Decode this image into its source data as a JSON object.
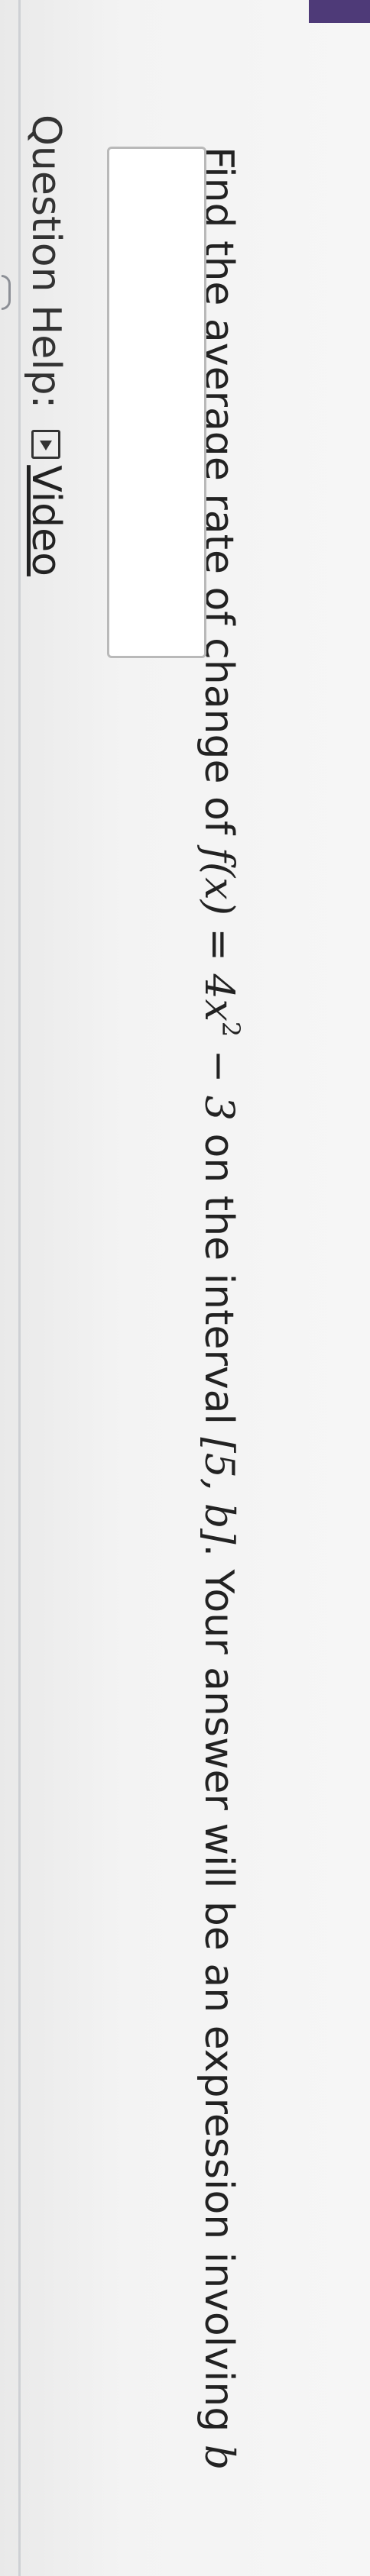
{
  "question": {
    "intro": "Find the average rate of change of ",
    "function_lhs": "f(x)",
    "equals": " = ",
    "function_coef": "4x",
    "function_exp": "2",
    "function_tail": " − 3",
    "on_interval": " on the interval ",
    "interval": "[5, b]",
    "instruction": ". Your answer will be an expression involving ",
    "variable": "b"
  },
  "answer_input": {
    "value": ""
  },
  "help": {
    "label": "Question Help:",
    "video_label": "Video",
    "video_icon": "play-video-icon"
  },
  "colors": {
    "top_band": "#4e3a78",
    "text": "#222222",
    "input_border": "#b9b9b9"
  }
}
